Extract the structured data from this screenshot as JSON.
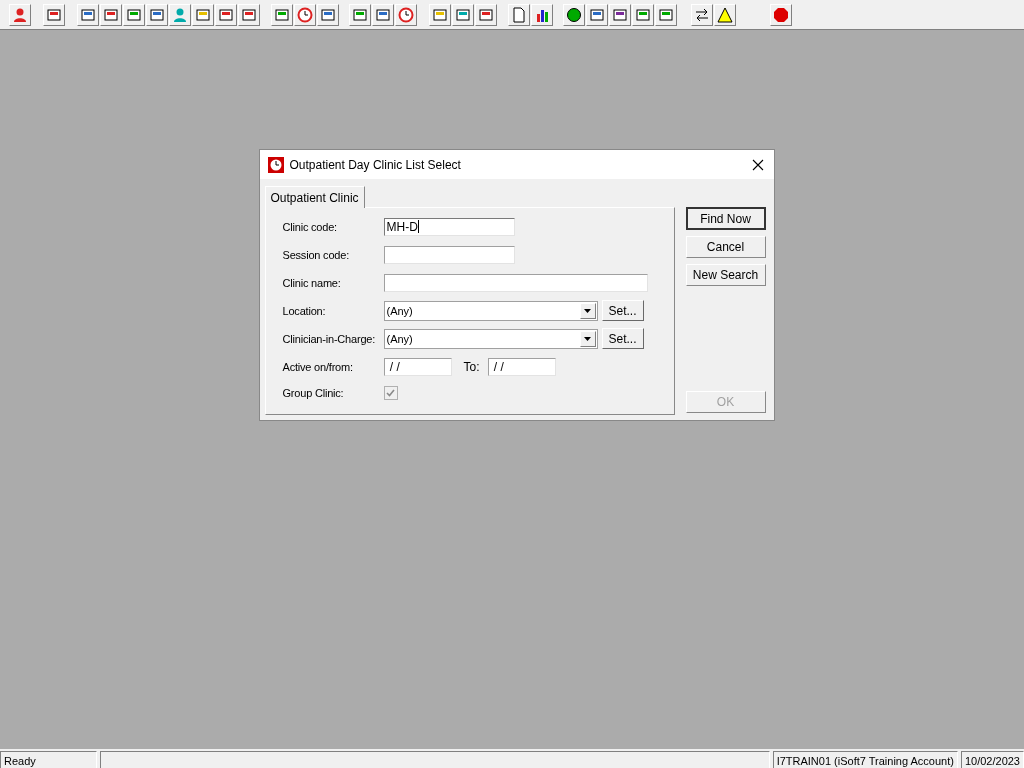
{
  "dialog": {
    "title": "Outpatient Day Clinic List Select",
    "tabs": [
      {
        "label": "Outpatient Clinic",
        "selected": true
      }
    ],
    "fields": [
      {
        "kind": "short",
        "label": "Clinic code:",
        "value": "MH-D",
        "focused": true
      },
      {
        "kind": "short",
        "label": "Session code:",
        "focused": false
      },
      {
        "kind": "long",
        "label": "Clinic name:",
        "focused": false
      },
      {
        "kind": "combo",
        "label": "Location:",
        "value": "(Any)",
        "button": "Set..."
      },
      {
        "kind": "combo",
        "label": "Clinician-in-Charge:",
        "value": "(Any)",
        "button": "Set..."
      },
      {
        "kind": "dates",
        "label": "Active on/from:",
        "value": "/ /",
        "to_label": "To:",
        "to_value": "/ /"
      },
      {
        "kind": "checkbox",
        "label": "Group Clinic:",
        "checked": true,
        "disabled": true
      }
    ],
    "buttons": [
      {
        "label": "Find Now",
        "default": true,
        "disabled": false
      },
      {
        "label": "Cancel",
        "default": false,
        "disabled": false
      },
      {
        "label": "New Search",
        "default": false,
        "disabled": false
      },
      {
        "label": "OK",
        "default": false,
        "disabled": true
      }
    ]
  },
  "status_bar": [
    "Ready",
    "I7TRAIN01 (iSoft7 Training Account)",
    "10/02/2023"
  ]
}
